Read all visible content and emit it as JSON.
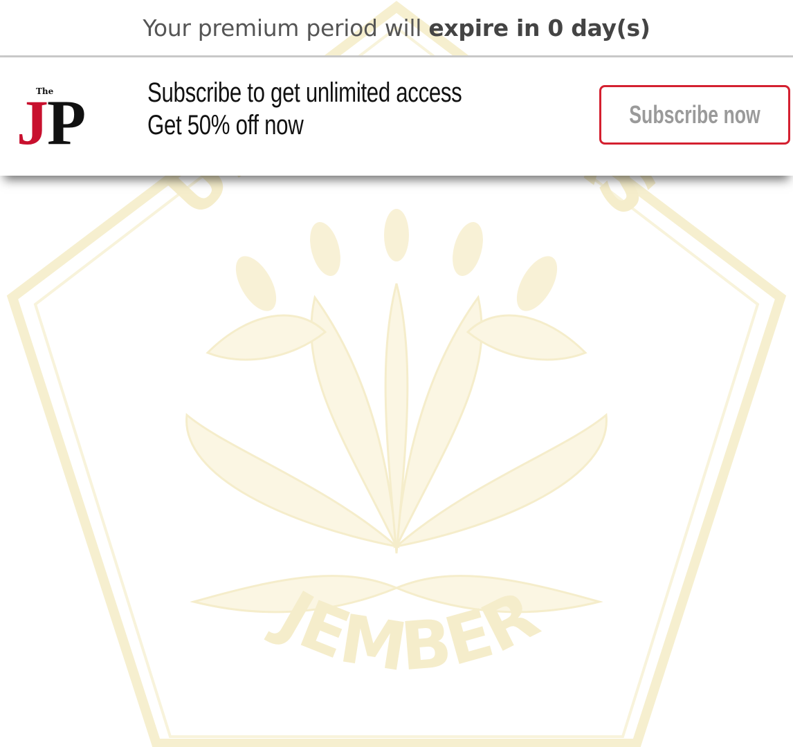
{
  "premium_notice": {
    "prefix": "Your premium period will ",
    "emphasis": "expire in 0 day(s)"
  },
  "subscribe_banner": {
    "logo": {
      "small_text": "The",
      "letter_j": "J",
      "letter_p": "P"
    },
    "headline": "Subscribe to get unlimited access",
    "subline": "Get 50% off now",
    "button_label": "Subscribe now"
  },
  "watermark": {
    "top_text": "UNIVERSITAS",
    "bottom_text": "JEMBER"
  },
  "colors": {
    "brand_red": "#c8102e",
    "button_border": "#d42030",
    "button_text": "#9a9a9a",
    "watermark_tint": "#f3e9b4"
  }
}
